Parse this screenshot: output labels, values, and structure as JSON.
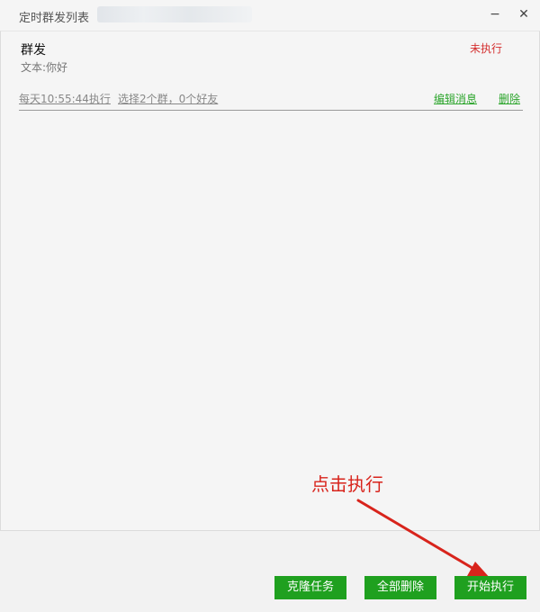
{
  "window": {
    "title": "定时群发列表",
    "minimize_glyph": "−",
    "close_glyph": "✕"
  },
  "tasks": [
    {
      "title": "群发",
      "status": "未执行",
      "content": "文本:你好",
      "schedule": "每天10:55:44执行",
      "target": "选择2个群，0个好友",
      "edit_label": "编辑消息",
      "delete_label": "删除"
    }
  ],
  "annotation": {
    "text": "点击执行"
  },
  "footer": {
    "clone_label": "克隆任务",
    "delete_all_label": "全部删除",
    "start_label": "开始执行"
  },
  "colors": {
    "accent_green": "#1fa01f",
    "status_red": "#d42f2f",
    "annotation_red": "#d8241c"
  },
  "icons": {
    "minimize": "minimize-icon",
    "close": "close-icon"
  }
}
